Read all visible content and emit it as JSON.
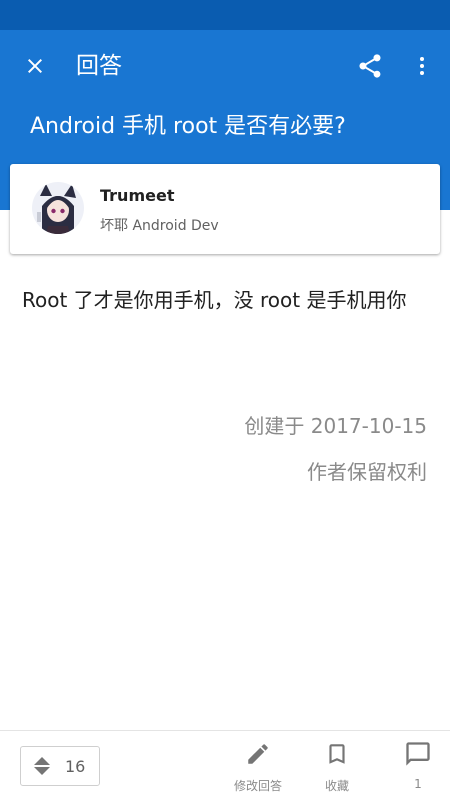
{
  "toolbar": {
    "title": "回答"
  },
  "question": {
    "title": "Android 手机 root 是否有必要?"
  },
  "author": {
    "name": "Trumeet",
    "bio": "坏耶 Android Dev"
  },
  "answer": {
    "text": "Root 了才是你用手机，没 root 是手机用你",
    "created": "创建于 2017-10-15",
    "rights": "作者保留权利"
  },
  "bottom": {
    "vote_count": "16",
    "edit_label": "修改回答",
    "favorite_label": "收藏",
    "comment_count": "1"
  },
  "icons": {
    "close": "close-icon",
    "share": "share-icon",
    "more": "more-vert-icon",
    "vote": "vote-arrows-icon",
    "edit": "pencil-icon",
    "favorite": "bookmark-icon",
    "comment": "comment-icon"
  },
  "colors": {
    "primary": "#1976d2",
    "status_bar": "#0a5cb0",
    "icon_gray": "#757575",
    "meta_text": "#8a8a8a"
  }
}
